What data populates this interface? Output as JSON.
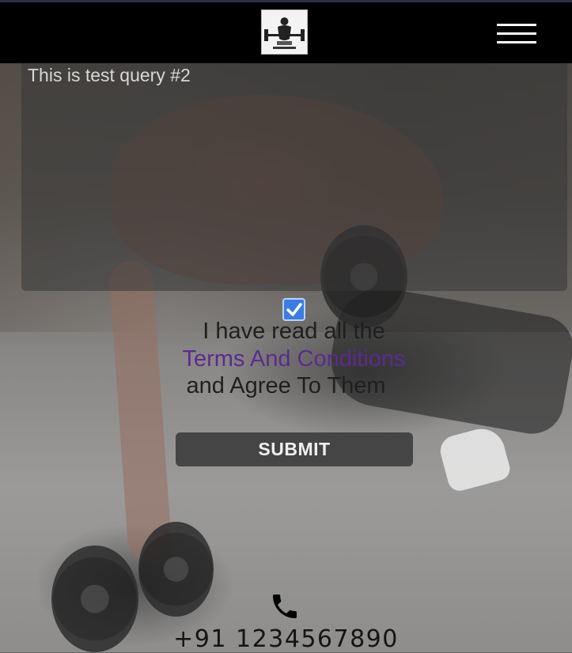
{
  "header": {
    "logo_icon": "gym-logo-icon",
    "menu_icon": "hamburger-menu-icon"
  },
  "form": {
    "query_value": "This is test query #2",
    "agree_checked": true,
    "agree_line1": "I have read all the",
    "terms_link": "Terms And Conditions",
    "agree_line2": "and Agree To Them",
    "submit_label": "SUBMIT"
  },
  "contact": {
    "phone_icon": "phone-icon",
    "phone_number": "+91 1234567890"
  },
  "colors": {
    "navbar": "#000000",
    "link": "#5a2b8f",
    "checkbox": "#3b7de0"
  }
}
